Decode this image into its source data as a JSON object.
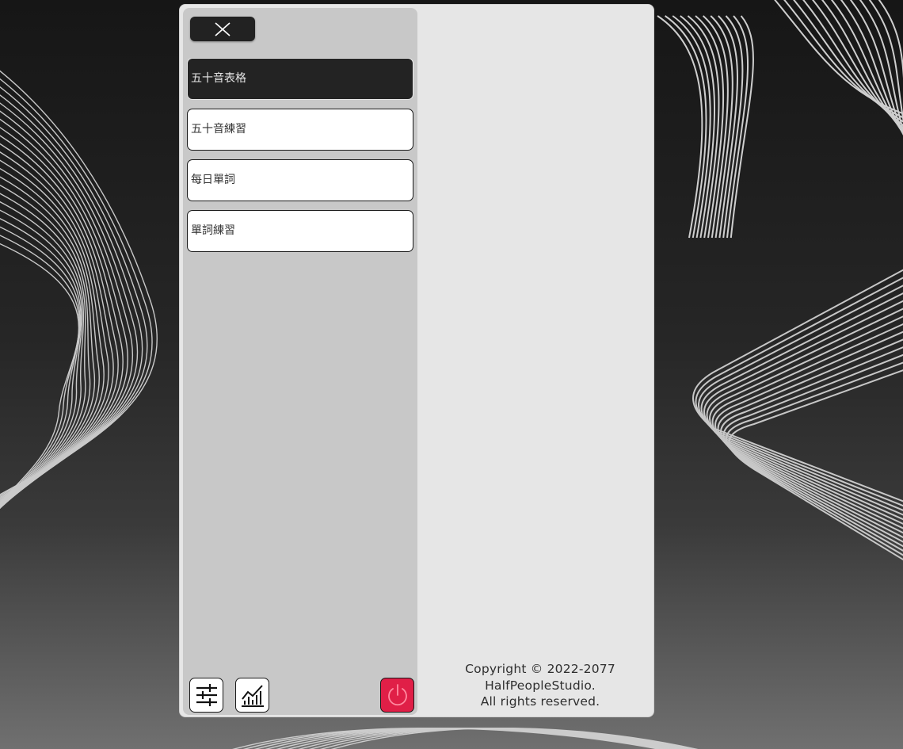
{
  "sidebar": {
    "close_icon": "close-icon",
    "menu": [
      {
        "label": "五十音表格",
        "active": true
      },
      {
        "label": "五十音練習",
        "active": false
      },
      {
        "label": "每日單詞",
        "active": false
      },
      {
        "label": "單詞練習",
        "active": false
      }
    ],
    "tools": {
      "settings_icon": "sliders-icon",
      "stats_icon": "chart-icon",
      "power_icon": "power-icon"
    }
  },
  "footer": {
    "line1": "Copyright © 2022-2077",
    "line2": "HalfPeopleStudio.",
    "line3": "All rights reserved."
  },
  "colors": {
    "active_item_bg": "#232323",
    "power_button": "#e01f47",
    "sidebar_bg": "#c8c8c8",
    "content_bg": "#e6e6e6"
  }
}
